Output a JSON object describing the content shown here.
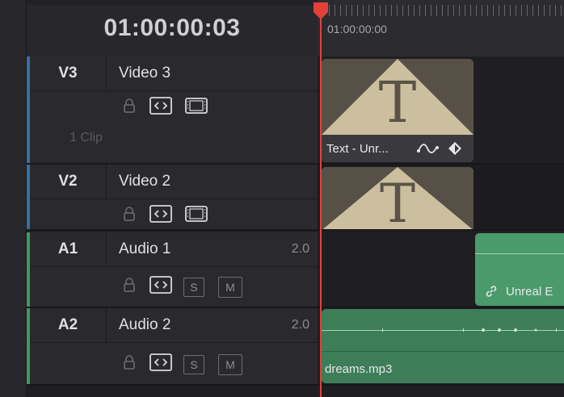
{
  "timecode": "01:00:00:03",
  "ruler": {
    "start_label": "01:00:00:00"
  },
  "tracks": [
    {
      "id": "V3",
      "name": "Video 3",
      "type": "video",
      "color": "#3c6ea0",
      "clip_count": "1 Clip"
    },
    {
      "id": "V2",
      "name": "Video 2",
      "type": "video",
      "color": "#3c6ea0"
    },
    {
      "id": "A1",
      "name": "Audio 1",
      "type": "audio",
      "color": "#3f9a5e",
      "channels": "2.0",
      "solo_label": "S",
      "mute_label": "M"
    },
    {
      "id": "A2",
      "name": "Audio 2",
      "type": "audio",
      "color": "#3f9a5e",
      "channels": "2.0",
      "solo_label": "S",
      "mute_label": "M"
    }
  ],
  "clips": {
    "v3_text": {
      "name": "Text - Unr..."
    },
    "a1_clip": {
      "name": "Unreal E"
    },
    "a2_clip": {
      "name": "dreams.mp3"
    }
  },
  "colors": {
    "playhead": "#e2413a",
    "title_clip": "#cbbf9f",
    "audio_clip_a1": "#4a9a6c",
    "audio_clip_a2": "#3d7d58"
  }
}
